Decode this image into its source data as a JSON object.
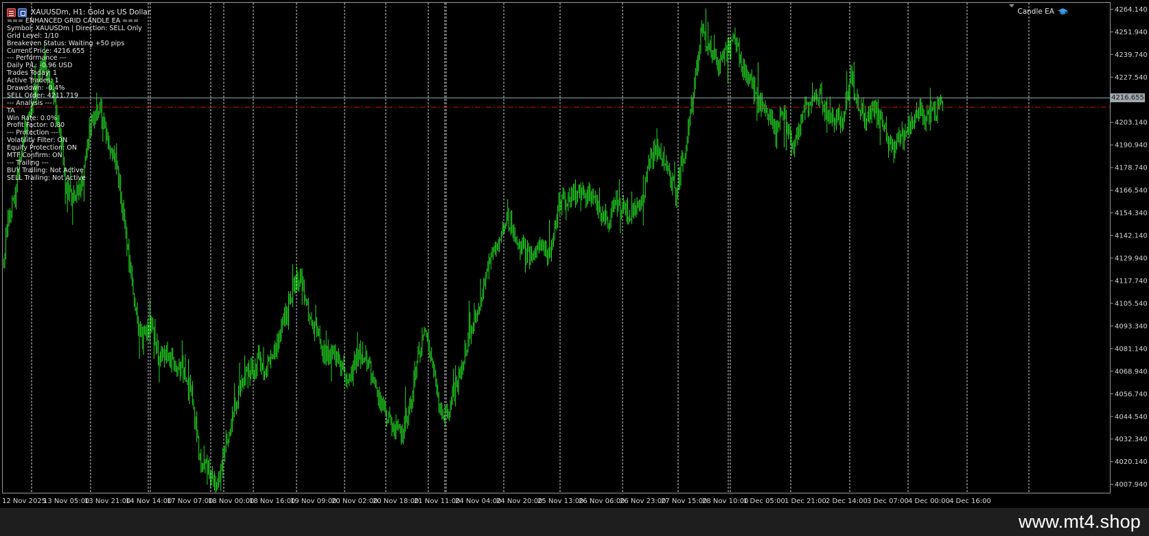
{
  "window": {
    "title": "XAUUSDm, H1:  Gold vs US Dollar",
    "ea_badge": "Candle EA"
  },
  "ea_panel": {
    "lines": [
      "=== ENHANCED GRID CANDLE EA ===",
      "Symbol: XAUUSDm | Direction: SELL Only",
      "Grid Level: 1/10",
      "Breakeven Status: Waiting +50 pips",
      "Current Price: 4216.655",
      "--- Performance ---",
      "Daily P/L: -0.96 USD",
      "Trades Today: 1",
      "Active Trades: 1",
      "Drawdown: -0.4%",
      "SELL Order: 4211.719",
      "--- Analysis ---",
      "TA",
      "Win Rate: 0.0%",
      "Profit Factor: 0.80",
      "--- Protection ---",
      "Volatility Filter: ON",
      "Equity Protection: ON",
      "MTF Confirm: ON",
      "--- Trailing ---",
      "BUY Trailing: Not Active",
      "SELL Trailing: Not Active"
    ]
  },
  "current_price_label": "4216.655",
  "price_axis": {
    "ticks": [
      "4264.140",
      "4251.940",
      "4239.740",
      "4227.540",
      "4203.140",
      "4190.940",
      "4178.740",
      "4166.540",
      "4154.340",
      "4142.140",
      "4129.940",
      "4117.740",
      "4105.540",
      "4093.340",
      "4081.140",
      "4068.940",
      "4056.740",
      "4044.540",
      "4032.340",
      "4020.140",
      "4007.940"
    ]
  },
  "time_axis": {
    "ticks": [
      "12 Nov 2025",
      "13 Nov 05:00",
      "13 Nov 21:00",
      "14 Nov 14:00",
      "17 Nov 07:00",
      "18 Nov 00:00",
      "18 Nov 16:00",
      "19 Nov 09:00",
      "20 Nov 02:00",
      "20 Nov 18:00",
      "21 Nov 11:00",
      "24 Nov 04:00",
      "24 Nov 20:00",
      "25 Nov 13:00",
      "26 Nov 06:00",
      "26 Nov 23:00",
      "27 Nov 15:00",
      "28 Nov 10:00",
      "1 Dec 05:00",
      "1 Dec 21:00",
      "2 Dec 14:00",
      "3 Dec 07:00",
      "4 Dec 00:00",
      "4 Dec 16:00"
    ]
  },
  "watermark": "www.mt4.shop",
  "colors": {
    "background": "#000000",
    "candle": "#22dd22",
    "grid": "#c8c8c8",
    "bid_line": "#7f9f9f",
    "order_line": "#d01010",
    "footer": "#1e1e1e"
  },
  "icons": [
    "chart-menu-icon",
    "chart-window-icon",
    "graduation-cap-icon"
  ],
  "chart_data": {
    "type": "candlestick",
    "symbol": "XAUUSDm",
    "timeframe": "H1",
    "y_range": [
      4003,
      4268
    ],
    "current_price": 4216.655,
    "sell_order_price": 4211.719,
    "close_path": [
      [
        0,
        4128
      ],
      [
        1,
        4150
      ],
      [
        3,
        4170
      ],
      [
        5,
        4200
      ],
      [
        7,
        4215
      ],
      [
        9,
        4235
      ],
      [
        11,
        4225
      ],
      [
        13,
        4205
      ],
      [
        15,
        4170
      ],
      [
        17,
        4160
      ],
      [
        19,
        4175
      ],
      [
        21,
        4205
      ],
      [
        23,
        4210
      ],
      [
        25,
        4195
      ],
      [
        27,
        4180
      ],
      [
        29,
        4150
      ],
      [
        31,
        4110
      ],
      [
        33,
        4085
      ],
      [
        35,
        4095
      ],
      [
        37,
        4080
      ],
      [
        39,
        4078
      ],
      [
        41,
        4072
      ],
      [
        43,
        4070
      ],
      [
        45,
        4060
      ],
      [
        47,
        4020
      ],
      [
        49,
        4015
      ],
      [
        51,
        4008
      ],
      [
        53,
        4030
      ],
      [
        55,
        4045
      ],
      [
        57,
        4065
      ],
      [
        59,
        4068
      ],
      [
        61,
        4075
      ],
      [
        63,
        4072
      ],
      [
        65,
        4080
      ],
      [
        67,
        4095
      ],
      [
        69,
        4112
      ],
      [
        71,
        4120
      ],
      [
        73,
        4100
      ],
      [
        75,
        4090
      ],
      [
        77,
        4078
      ],
      [
        79,
        4080
      ],
      [
        81,
        4070
      ],
      [
        83,
        4065
      ],
      [
        85,
        4080
      ],
      [
        87,
        4075
      ],
      [
        89,
        4060
      ],
      [
        91,
        4050
      ],
      [
        93,
        4040
      ],
      [
        95,
        4035
      ],
      [
        97,
        4045
      ],
      [
        99,
        4075
      ],
      [
        101,
        4090
      ],
      [
        103,
        4070
      ],
      [
        105,
        4045
      ],
      [
        107,
        4050
      ],
      [
        109,
        4065
      ],
      [
        111,
        4085
      ],
      [
        113,
        4100
      ],
      [
        115,
        4115
      ],
      [
        117,
        4135
      ],
      [
        119,
        4140
      ],
      [
        121,
        4150
      ],
      [
        123,
        4140
      ],
      [
        125,
        4135
      ],
      [
        127,
        4130
      ],
      [
        129,
        4140
      ],
      [
        131,
        4130
      ],
      [
        133,
        4160
      ],
      [
        135,
        4160
      ],
      [
        137,
        4165
      ],
      [
        139,
        4165
      ],
      [
        141,
        4162
      ],
      [
        143,
        4155
      ],
      [
        145,
        4150
      ],
      [
        147,
        4160
      ],
      [
        149,
        4155
      ],
      [
        151,
        4155
      ],
      [
        153,
        4160
      ],
      [
        155,
        4185
      ],
      [
        157,
        4190
      ],
      [
        159,
        4180
      ],
      [
        161,
        4165
      ],
      [
        163,
        4185
      ],
      [
        165,
        4215
      ],
      [
        167,
        4250
      ],
      [
        169,
        4245
      ],
      [
        171,
        4235
      ],
      [
        173,
        4240
      ],
      [
        175,
        4250
      ],
      [
        177,
        4235
      ],
      [
        179,
        4225
      ],
      [
        181,
        4215
      ],
      [
        183,
        4210
      ],
      [
        185,
        4200
      ],
      [
        187,
        4210
      ],
      [
        189,
        4190
      ],
      [
        191,
        4205
      ],
      [
        193,
        4215
      ],
      [
        195,
        4220
      ],
      [
        197,
        4210
      ],
      [
        199,
        4205
      ],
      [
        201,
        4205
      ],
      [
        203,
        4230
      ],
      [
        205,
        4210
      ],
      [
        207,
        4205
      ],
      [
        209,
        4210
      ],
      [
        211,
        4200
      ],
      [
        213,
        4190
      ],
      [
        215,
        4195
      ],
      [
        217,
        4200
      ],
      [
        219,
        4210
      ],
      [
        221,
        4205
      ],
      [
        223,
        4210
      ],
      [
        225,
        4215
      ]
    ]
  }
}
